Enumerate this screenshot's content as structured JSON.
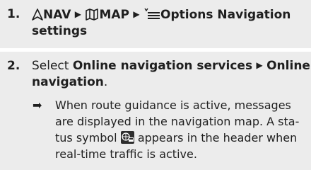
{
  "step1": {
    "number": "1.",
    "nav_label": "NAV",
    "map_label": "MAP",
    "options_text": "Options Navigation",
    "settings_text": "settings"
  },
  "step2": {
    "number": "2.",
    "select_word": "Select",
    "menu_item": "Online navigation services",
    "submenu_line1": "Online",
    "submenu_line2": "navigation",
    "period": ".",
    "result_marker": "➡",
    "result_lines": [
      "When route guidance is active, messages",
      "are displayed in the navigation map. A sta-",
      "tus symbol",
      "appears in the header when",
      "real-time traffic is active."
    ]
  },
  "icons": {
    "nav": "navigation-arrow-icon",
    "map": "map-icon",
    "menu": "options-menu-icon",
    "arrow": "triangle-right-icon",
    "traffic": "realtime-traffic-status-icon"
  }
}
